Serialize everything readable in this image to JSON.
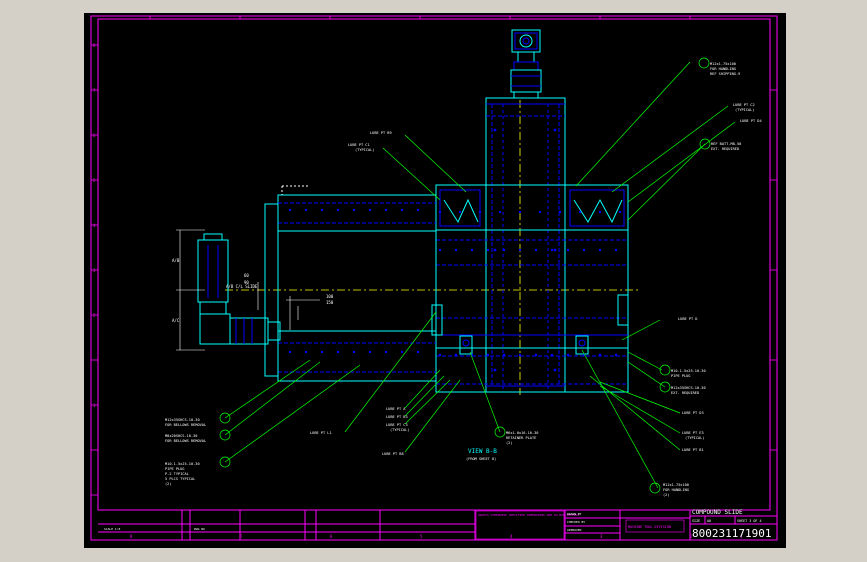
{
  "drawing": {
    "title": "COMPOUND SLIDE",
    "drawing_number": "800231171901",
    "view_label": "VIEW B-B",
    "view_sub": "(FROM SHEET 8)",
    "sheet_label": "SHEET 3 OF 4",
    "size_label": "SIZE",
    "size_value": "A0",
    "scale_label": "SCALE 1:8",
    "dwg_label": "DWG NO"
  },
  "callouts_left": {
    "lube_pt_b": "LUBE PT B9",
    "lube_pt_c": "LUBE PT C1",
    "lube_pt_c_sub": "(TYPICAL)",
    "bolt_a_1": "M12x35SHCS-10-30",
    "bolt_a_2": "FOR BELLOWS REMOVAL",
    "bolt_b_1": "M8x20SHCS-10-30",
    "bolt_b_2": "FOR BELLOWS REMOVAL",
    "bolt_c_1": "M10-1.5x25-10-30",
    "bolt_c_2": "PIPE PLUG",
    "bolt_c_3": "P-2 TYPICAL",
    "bolt_c_4": "5 PLCS TYPICAL",
    "bolt_c_5": "(2)",
    "lube_pt_l": "LUBE PT L1"
  },
  "callouts_right": {
    "top_1": "M12x1.75x100",
    "top_2": "FOR HANDLING",
    "top_3": "REF SHIPPING-9",
    "lube_c2": "LUBE PT C2",
    "lube_c2_sub": "(TYPICAL)",
    "lube_d4": "LUBE PT D4",
    "ref_1": "REF BATT-M8-50",
    "ref_2": "EXT. REQUIRED",
    "lube_d": "LUBE PT D",
    "mid_1": "M10-1.5x25-10-30",
    "mid_2": "PIPE PLUG",
    "mid_3": "M12x35SHCS-10-30",
    "mid_4": "EXT. REQUIRED",
    "lube_d3": "LUBE PT D3",
    "lube_e3": "LUBE PT E3",
    "lube_e3_sub": "(TYPICAL)",
    "lube_b1": "LUBE PT B1",
    "bot_1": "M12x1.75x100",
    "bot_2": "FOR HANDLING",
    "bot_3": "(2)"
  },
  "callouts_bottom": {
    "lube_a": "LUBE PT A",
    "lube_b3": "LUBE PT B3",
    "lube_c3": "LUBE PT C3",
    "lube_c3_sub": "(TYPICAL)",
    "lube_b8": "LUBE PT B8",
    "wiper_1": "M6x1.0x16-10-30",
    "wiper_2": "RETAINER PLATE",
    "wiper_3": "(2)"
  },
  "dims": {
    "dim_ab": "A/B",
    "dim_ac": "A/C",
    "dim_60": "60",
    "dim_90": "90",
    "dim_100": "100",
    "dim_150": "150",
    "datum": "A/B C/L SLIDE"
  },
  "border": {
    "row_ticks": [
      "8",
      "7",
      "6",
      "5",
      "4",
      "3",
      "2",
      "1"
    ],
    "col_ticks": [
      "8",
      "7",
      "6",
      "5",
      "4",
      "3",
      "2",
      "1"
    ]
  },
  "title_block": {
    "note": "UNLESS OTHERWISE SPECIFIED DIMENSIONS ARE IN MILLIMETERS",
    "company": "MACHINE TOOL DIVISION",
    "drawn_label": "DRAWN BY",
    "checked_label": "CHECKED BY",
    "approved_label": "APPROVED"
  },
  "colors": {
    "background": "#000000",
    "border": "#ff00ff",
    "part": "#00ffff",
    "detail": "#0000ff",
    "leader": "#00ff00",
    "text": "#ffffff",
    "centerline": "#ffff00"
  }
}
